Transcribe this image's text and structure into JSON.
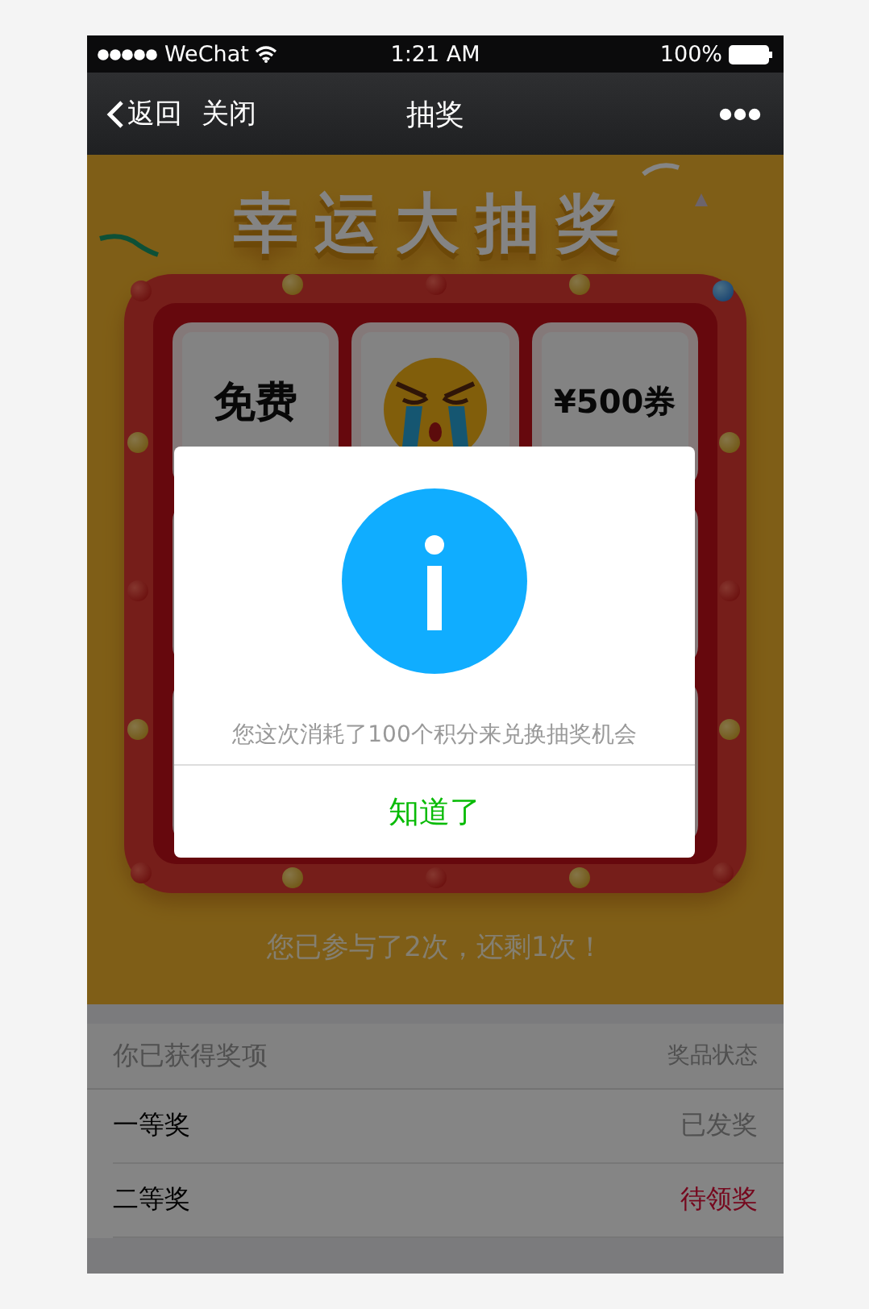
{
  "status_bar": {
    "carrier": "WeChat",
    "time": "1:21 AM",
    "battery": "100%"
  },
  "nav_bar": {
    "back": "返回",
    "close": "关闭",
    "title": "抽奖"
  },
  "banner": {
    "title": "幸运大抽奖"
  },
  "prize_grid": {
    "cells": [
      {
        "kind": "text",
        "label": "免费"
      },
      {
        "kind": "emoji"
      },
      {
        "kind": "text",
        "label": "¥500券"
      },
      {
        "kind": "blank"
      },
      {
        "kind": "blank"
      },
      {
        "kind": "blank"
      },
      {
        "kind": "blank"
      }
    ]
  },
  "attempts": "您已参与了2次，还剩1次！",
  "prizes": {
    "header": "你已获得奖项",
    "status_header": "奖品状态",
    "rows": [
      {
        "name": "一等奖",
        "status": "已发奖",
        "kind": "issued"
      },
      {
        "name": "二等奖",
        "status": "待领奖",
        "kind": "pending"
      }
    ]
  },
  "dialog": {
    "message": "您这次消耗了100个积分来兑换抽奖机会",
    "button": "知道了"
  }
}
